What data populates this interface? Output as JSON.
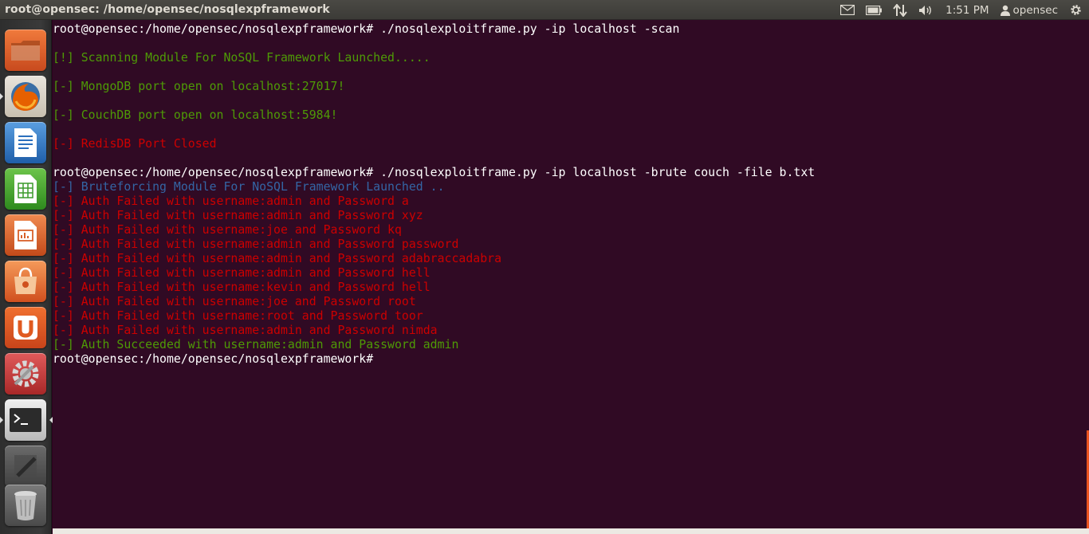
{
  "window_title": "root@opensec: /home/opensec/nosqlexpframework",
  "panel": {
    "time": "1:51 PM",
    "user": "opensec",
    "icons": [
      "mail-icon",
      "battery-icon",
      "network-arrows-icon",
      "volume-icon",
      "user-icon",
      "gear-icon"
    ]
  },
  "launcher": [
    {
      "name": "files-icon",
      "color": "#e0622d"
    },
    {
      "name": "firefox-icon",
      "color": "#e66000"
    },
    {
      "name": "writer-icon",
      "color": "#2a6fbd"
    },
    {
      "name": "calc-icon",
      "color": "#3a9a2a"
    },
    {
      "name": "impress-icon",
      "color": "#d8602a"
    },
    {
      "name": "software-center-icon",
      "color": "#e06a30"
    },
    {
      "name": "ubuntu-one-icon",
      "color": "#e05a20"
    },
    {
      "name": "system-settings-icon",
      "color": "#c83a3a"
    },
    {
      "name": "terminal-icon",
      "color": "#d4d4d4"
    },
    {
      "name": "workspace-switcher-icon",
      "color": "#555555"
    },
    {
      "name": "trash-icon",
      "color": "#606060"
    }
  ],
  "terminal": {
    "lines": [
      {
        "text": "root@opensec:/home/opensec/nosqlexpframework# ./nosqlexploitframe.py -ip localhost -scan",
        "color": "white"
      },
      {
        "text": "",
        "color": "white"
      },
      {
        "text": "[!] Scanning Module For NoSQL Framework Launched.....",
        "color": "green"
      },
      {
        "text": "",
        "color": "white"
      },
      {
        "text": "[-] MongoDB port open on localhost:27017!",
        "color": "green"
      },
      {
        "text": "",
        "color": "white"
      },
      {
        "text": "[-] CouchDB port open on localhost:5984!",
        "color": "green"
      },
      {
        "text": "",
        "color": "white"
      },
      {
        "text": "[-] RedisDB Port Closed",
        "color": "red"
      },
      {
        "text": "",
        "color": "white"
      },
      {
        "text": "root@opensec:/home/opensec/nosqlexpframework# ./nosqlexploitframe.py -ip localhost -brute couch -file b.txt",
        "color": "white"
      },
      {
        "text": "[-] Bruteforcing Module For NoSQL Framework Launched ..",
        "color": "blue"
      },
      {
        "text": "[-] Auth Failed with username:admin and Password a",
        "color": "red"
      },
      {
        "text": "[-] Auth Failed with username:admin and Password xyz",
        "color": "red"
      },
      {
        "text": "[-] Auth Failed with username:joe and Password kq",
        "color": "red"
      },
      {
        "text": "[-] Auth Failed with username:admin and Password password",
        "color": "red"
      },
      {
        "text": "[-] Auth Failed with username:admin and Password adabraccadabra",
        "color": "red"
      },
      {
        "text": "[-] Auth Failed with username:admin and Password hell",
        "color": "red"
      },
      {
        "text": "[-] Auth Failed with username:kevin and Password hell",
        "color": "red"
      },
      {
        "text": "[-] Auth Failed with username:joe and Password root",
        "color": "red"
      },
      {
        "text": "[-] Auth Failed with username:root and Password toor",
        "color": "red"
      },
      {
        "text": "[-] Auth Failed with username:admin and Password nimda",
        "color": "red"
      },
      {
        "text": "[-] Auth Succeeded with username:admin and Password admin",
        "color": "green"
      },
      {
        "text": "root@opensec:/home/opensec/nosqlexpframework# ",
        "color": "white"
      }
    ]
  }
}
